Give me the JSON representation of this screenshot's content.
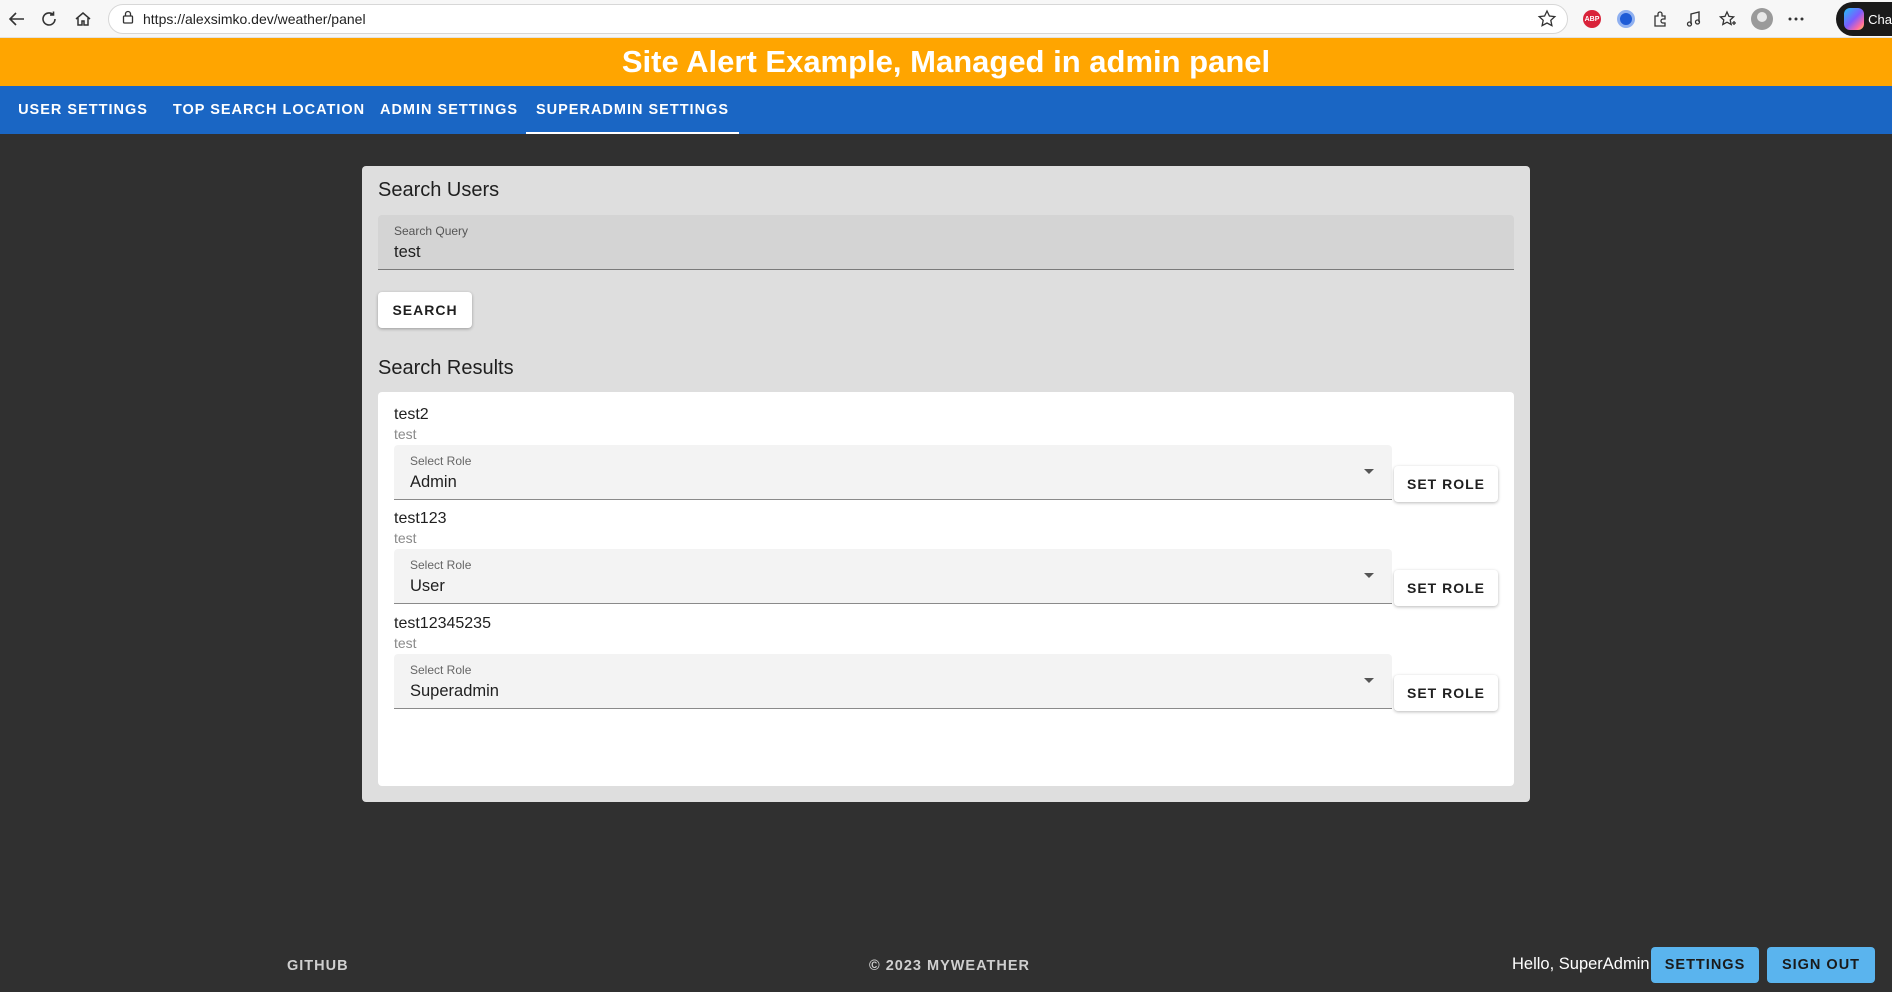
{
  "browser": {
    "url": "https://alexsimko.dev/weather/panel",
    "copilot_label": "Cha"
  },
  "alert": {
    "text": "Site Alert Example, Managed in admin panel"
  },
  "tabs": [
    {
      "label": "USER SETTINGS"
    },
    {
      "label": "TOP SEARCH LOCATION"
    },
    {
      "label": "ADMIN SETTINGS"
    },
    {
      "label": "SUPERADMIN SETTINGS"
    }
  ],
  "search": {
    "title": "Search Users",
    "query_label": "Search Query",
    "query_value": "test",
    "button": "SEARCH"
  },
  "results": {
    "title": "Search Results",
    "select_label": "Select Role",
    "button": "SET ROLE",
    "items": [
      {
        "name": "test2",
        "sub": "test",
        "role": "Admin"
      },
      {
        "name": "test123",
        "sub": "test",
        "role": "User"
      },
      {
        "name": "test12345235",
        "sub": "test",
        "role": "Superadmin"
      }
    ]
  },
  "footer": {
    "github": "GITHUB",
    "copyright": "© 2023 MYWEATHER",
    "hello": "Hello, SuperAdmin",
    "settings": "SETTINGS",
    "signout": "SIGN OUT"
  }
}
